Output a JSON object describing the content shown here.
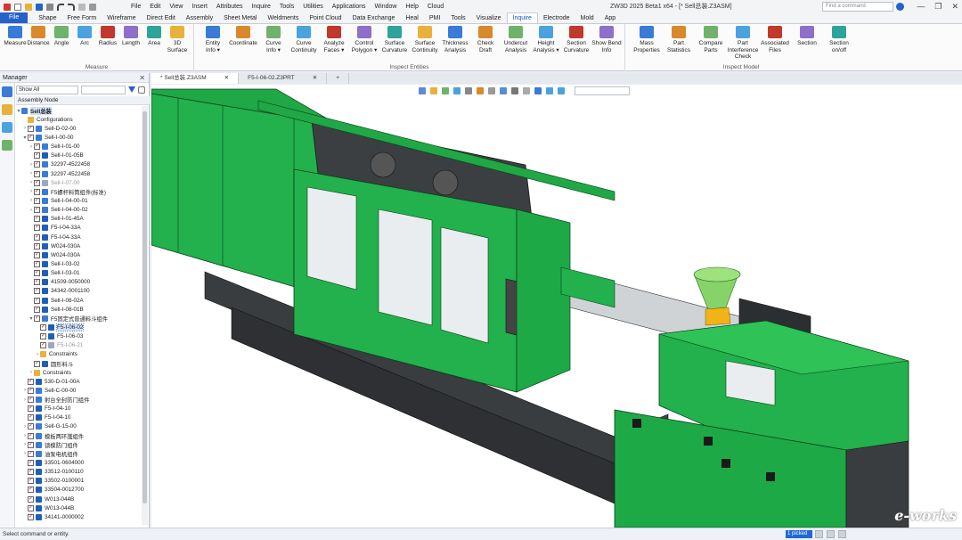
{
  "app_title": "ZW3D 2025 Beta1 x64 - [* Sell总装.Z3ASM]",
  "search_placeholder": "Find a command",
  "window_controls": [
    "—",
    "❐",
    "✕"
  ],
  "menus": [
    "File",
    "Edit",
    "View",
    "Insert",
    "Attributes",
    "Inquire",
    "Tools",
    "Utilities",
    "Applications",
    "Window",
    "Help",
    "Cloud"
  ],
  "ribbon_tabs": [
    "File",
    "Shape",
    "Free Form",
    "Wireframe",
    "Direct Edit",
    "Assembly",
    "Sheet Metal",
    "Weldments",
    "Point Cloud",
    "Data Exchange",
    "Heal",
    "PMI",
    "Tools",
    "Visualize",
    "Inquire",
    "Electrode",
    "Mold",
    "App"
  ],
  "active_tab": "Inquire",
  "ribbon": {
    "measure": {
      "label": "Measure",
      "buttons": [
        "Measure",
        "Distance",
        "Angle",
        "Arc",
        "Radius",
        "Length",
        "Area",
        "3D Surface"
      ]
    },
    "inspect_entities": {
      "label": "Inspect Entities",
      "buttons": [
        [
          "Entity",
          "Info ▾"
        ],
        [
          "Coordinate",
          ""
        ],
        [
          "Curve",
          "Info ▾"
        ],
        [
          "Curve",
          "Continuity"
        ],
        [
          "Analyze",
          "Faces ▾"
        ],
        [
          "Control",
          "Polygon ▾"
        ],
        [
          "Surface",
          "Curvature"
        ],
        [
          "Surface",
          "Continuity"
        ],
        [
          "Thickness",
          "Analysis"
        ],
        [
          "Check",
          "Draft"
        ],
        [
          "Undercut",
          "Analysis"
        ],
        [
          "Height",
          "Analysis ▾"
        ],
        [
          "Section",
          "Curvature"
        ],
        [
          "Show Bend",
          "Info"
        ]
      ]
    },
    "inspect_model": {
      "label": "Inspect Model",
      "buttons": [
        [
          "Mass",
          "Properties"
        ],
        [
          "Part",
          "Statistics"
        ],
        [
          "Compare",
          "Parts"
        ],
        [
          "Part Interference",
          "Check"
        ],
        [
          "Associated",
          "Files"
        ],
        [
          "Section",
          ""
        ],
        [
          "Section",
          "on/off"
        ]
      ]
    }
  },
  "manager": {
    "title": "Manager",
    "close": "✕",
    "filter_value": "Show All",
    "header": "Assembly Node",
    "tree": [
      {
        "label": "Sell总装",
        "indent": 0,
        "exp": "▾",
        "cb": false,
        "icon": "#3a7bd5",
        "root": true
      },
      {
        "label": "Configurations",
        "indent": 1,
        "exp": "",
        "cb": false,
        "icon": "#e8b23a"
      },
      {
        "label": "Sell-D-02-00",
        "indent": 1,
        "exp": "›",
        "cb": true,
        "icon": "#3a7bd5"
      },
      {
        "label": "Sell-I-00-00",
        "indent": 1,
        "exp": "▾",
        "cb": true,
        "icon": "#3a7bd5"
      },
      {
        "label": "Sell-I-01-00",
        "indent": 2,
        "exp": "›",
        "cb": true,
        "icon": "#3a7bd5"
      },
      {
        "label": "Sell-I-01-05B",
        "indent": 2,
        "exp": "",
        "cb": true,
        "icon": "#1f5fb8"
      },
      {
        "label": "32297-4522458",
        "indent": 2,
        "exp": "›",
        "cb": true,
        "icon": "#3a7bd5"
      },
      {
        "label": "32297-4522458",
        "indent": 2,
        "exp": "›",
        "cb": true,
        "icon": "#3a7bd5"
      },
      {
        "label": "Sell-I-07-00",
        "indent": 2,
        "exp": "›",
        "cb": true,
        "icon": "#9aa9c0",
        "dim": true
      },
      {
        "label": "F5螺杆料筒组件(标准)",
        "indent": 2,
        "exp": "›",
        "cb": true,
        "icon": "#3a7bd5"
      },
      {
        "label": "Sell-I-04-00-01",
        "indent": 2,
        "exp": "›",
        "cb": true,
        "icon": "#3a7bd5"
      },
      {
        "label": "Sell-I-04-00-02",
        "indent": 2,
        "exp": "›",
        "cb": true,
        "icon": "#3a7bd5"
      },
      {
        "label": "Sell-I-01-45A",
        "indent": 2,
        "exp": "",
        "cb": true,
        "icon": "#1f5fb8"
      },
      {
        "label": "F5-I-04-33A",
        "indent": 2,
        "exp": "",
        "cb": true,
        "icon": "#1f5fb8"
      },
      {
        "label": "F5-I-04-33A",
        "indent": 2,
        "exp": "",
        "cb": true,
        "icon": "#1f5fb8"
      },
      {
        "label": "W024-030A",
        "indent": 2,
        "exp": "",
        "cb": true,
        "icon": "#1f5fb8"
      },
      {
        "label": "W024-030A",
        "indent": 2,
        "exp": "",
        "cb": true,
        "icon": "#1f5fb8"
      },
      {
        "label": "Sell-I-03-02",
        "indent": 2,
        "exp": "",
        "cb": true,
        "icon": "#1f5fb8"
      },
      {
        "label": "Sell-I-03-01",
        "indent": 2,
        "exp": "",
        "cb": true,
        "icon": "#1f5fb8"
      },
      {
        "label": "41509-0050000",
        "indent": 2,
        "exp": "",
        "cb": true,
        "icon": "#1f5fb8"
      },
      {
        "label": "34342-0001100",
        "indent": 2,
        "exp": "",
        "cb": true,
        "icon": "#1f5fb8"
      },
      {
        "label": "Sell-I-08-02A",
        "indent": 2,
        "exp": "",
        "cb": true,
        "icon": "#1f5fb8"
      },
      {
        "label": "Sell-I-08-01B",
        "indent": 2,
        "exp": "",
        "cb": true,
        "icon": "#1f5fb8"
      },
      {
        "label": "F5固定式普通料斗组件",
        "indent": 2,
        "exp": "▾",
        "cb": true,
        "icon": "#3a7bd5"
      },
      {
        "label": "F5-I-06-02",
        "indent": 3,
        "exp": "",
        "cb": true,
        "icon": "#1f5fb8",
        "selected": true
      },
      {
        "label": "F5-I-06-03",
        "indent": 3,
        "exp": "",
        "cb": true,
        "icon": "#1f5fb8"
      },
      {
        "label": "F5-I-06-21",
        "indent": 3,
        "exp": "",
        "cb": true,
        "icon": "#9aa9c0",
        "dim": true
      },
      {
        "label": "Constraints",
        "indent": 3,
        "exp": "›",
        "cb": false,
        "icon": "#e8b23a"
      },
      {
        "label": "圆形料斗",
        "indent": 2,
        "exp": "",
        "cb": true,
        "icon": "#1f5fb8"
      },
      {
        "label": "Constraints",
        "indent": 2,
        "exp": "›",
        "cb": false,
        "icon": "#e8b23a"
      },
      {
        "label": "530-D-01-00A",
        "indent": 1,
        "exp": "",
        "cb": true,
        "icon": "#1f5fb8"
      },
      {
        "label": "Sell-C-00-00",
        "indent": 1,
        "exp": "›",
        "cb": true,
        "icon": "#3a7bd5"
      },
      {
        "label": "射台全封防门组件",
        "indent": 1,
        "exp": "›",
        "cb": true,
        "icon": "#3a7bd5"
      },
      {
        "label": "F5-I-04-10",
        "indent": 1,
        "exp": "",
        "cb": true,
        "icon": "#1f5fb8"
      },
      {
        "label": "F5-I-04-10",
        "indent": 1,
        "exp": "",
        "cb": true,
        "icon": "#1f5fb8"
      },
      {
        "label": "Sell-G-15-00",
        "indent": 1,
        "exp": "›",
        "cb": true,
        "icon": "#3a7bd5"
      },
      {
        "label": "模板两环護组件",
        "indent": 1,
        "exp": "›",
        "cb": true,
        "icon": "#3a7bd5"
      },
      {
        "label": "锁模防门组件",
        "indent": 1,
        "exp": "›",
        "cb": true,
        "icon": "#3a7bd5"
      },
      {
        "label": "油泵电机组件",
        "indent": 1,
        "exp": "›",
        "cb": true,
        "icon": "#3a7bd5"
      },
      {
        "label": "33501-0604000",
        "indent": 1,
        "exp": "",
        "cb": true,
        "icon": "#1f5fb8"
      },
      {
        "label": "33512-0100110",
        "indent": 1,
        "exp": "",
        "cb": true,
        "icon": "#1f5fb8"
      },
      {
        "label": "33502-0100001",
        "indent": 1,
        "exp": "",
        "cb": true,
        "icon": "#1f5fb8"
      },
      {
        "label": "33504-0012700",
        "indent": 1,
        "exp": "",
        "cb": true,
        "icon": "#1f5fb8"
      },
      {
        "label": "W013-044B",
        "indent": 1,
        "exp": "",
        "cb": true,
        "icon": "#1f5fb8"
      },
      {
        "label": "W013-044B",
        "indent": 1,
        "exp": "",
        "cb": true,
        "icon": "#1f5fb8"
      },
      {
        "label": "34141-0000002",
        "indent": 1,
        "exp": "",
        "cb": true,
        "icon": "#1f5fb8"
      }
    ]
  },
  "doc_tabs": [
    {
      "label": "* Sell总装.Z3ASM",
      "close": "✕",
      "active": true
    },
    {
      "label": "F5-I-06-02.Z3PRT",
      "close": "✕",
      "active": false
    },
    {
      "label": "+",
      "close": "",
      "active": false
    }
  ],
  "status": {
    "text": "Select command or entity.",
    "picked": "1 picked"
  },
  "watermark": "e-works",
  "colors": {
    "accent": "#2563c9",
    "machine_green": "#22b14c",
    "machine_dark": "#3a3d40",
    "hopper": "#86d36a",
    "selection": "#cfe1fb"
  }
}
